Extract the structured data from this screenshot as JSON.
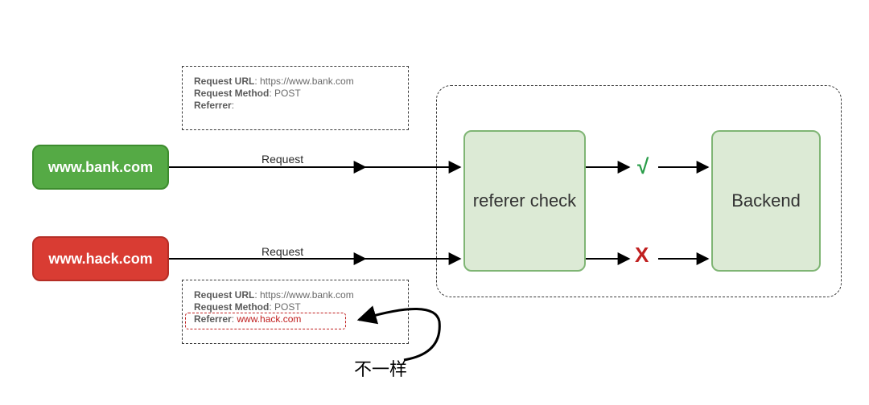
{
  "sites": {
    "bank": "www.bank.com",
    "hack": "www.hack.com"
  },
  "edges": {
    "request1": "Request",
    "request2": "Request"
  },
  "info_top": {
    "url_label": "Request URL",
    "url_value": ": https://www.bank.com",
    "method_label": "Request Method",
    "method_value": ": POST",
    "referrer_label": "Referrer",
    "referrer_value": ":"
  },
  "info_bottom": {
    "url_label": "Request URL",
    "url_value": ": https://www.bank.com",
    "method_label": "Request Method",
    "method_value": ": POST",
    "referrer_label": "Referrer",
    "referrer_value": ": ",
    "referrer_host": "www.hack.com"
  },
  "green_boxes": {
    "referer": "referer check",
    "backend": "Backend"
  },
  "marks": {
    "pass": "√",
    "fail": "X"
  },
  "annotation": "不一样"
}
